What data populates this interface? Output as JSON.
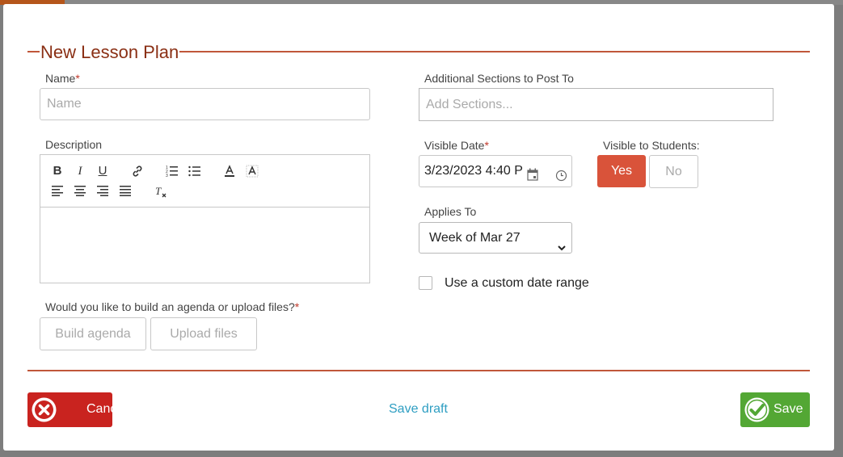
{
  "modal": {
    "title": "New Lesson Plan"
  },
  "name_field": {
    "label": "Name",
    "required_mark": "*",
    "placeholder": "Name",
    "value": ""
  },
  "description": {
    "label": "Description",
    "toolbar": [
      "bold-icon",
      "italic-icon",
      "underline-icon",
      "link-icon",
      "ordered-list-icon",
      "bullet-list-icon",
      "text-color-icon",
      "highlight-icon",
      "align-left-icon",
      "align-center-icon",
      "align-right-icon",
      "align-justify-icon",
      "clear-format-icon"
    ]
  },
  "agenda": {
    "question": "Would you like to build an agenda or upload files?",
    "required_mark": "*",
    "build_label": "Build agenda",
    "upload_label": "Upload files"
  },
  "sections": {
    "label": "Additional Sections to Post To",
    "placeholder": "Add Sections..."
  },
  "visible_date": {
    "label": "Visible Date",
    "required_mark": "*",
    "value": "3/23/2023 4:40 P"
  },
  "visible_students": {
    "label": "Visible to Students:",
    "yes_label": "Yes",
    "no_label": "No",
    "selected": "Yes"
  },
  "applies_to": {
    "label": "Applies To",
    "value": "Week of Mar 27"
  },
  "custom_range": {
    "label": "Use a custom date range",
    "checked": false
  },
  "footer": {
    "cancel_label": "Cancel",
    "save_draft_label": "Save draft",
    "save_label": "Save"
  },
  "colors": {
    "accent": "#c0573a",
    "title": "#8a2f14",
    "cancel": "#c9231f",
    "save": "#53a734",
    "yes": "#d9533a",
    "link": "#2e9ec2"
  }
}
